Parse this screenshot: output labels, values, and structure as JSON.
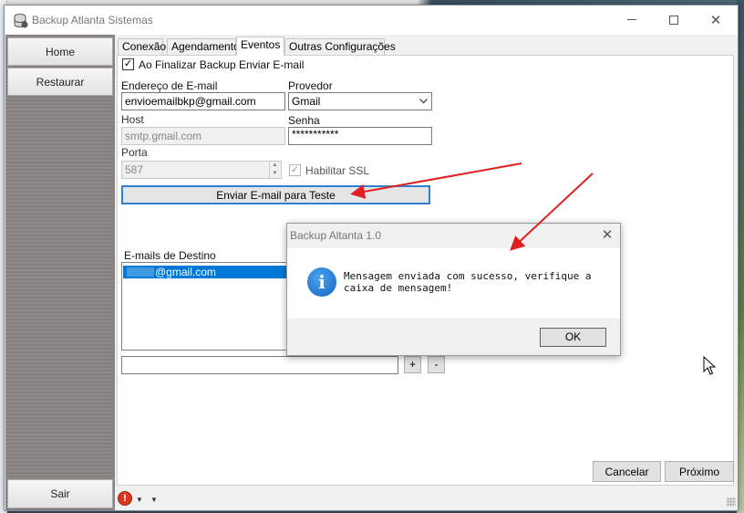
{
  "window": {
    "title": "Backup Atlanta Sistemas"
  },
  "sidebar": {
    "home_label": "Home",
    "restore_label": "Restaurar",
    "exit_label": "Sair"
  },
  "tabs": [
    {
      "label": "Conexão"
    },
    {
      "label": "Agendamento"
    },
    {
      "label": "Eventos",
      "active": true
    },
    {
      "label": "Outras Configurações"
    }
  ],
  "form": {
    "send_on_finish_label": "Ao Finalizar Backup Enviar E-mail",
    "send_on_finish_checked": true,
    "email_label": "Endereço de E-mail",
    "email_value": "envioemailbkp@gmail.com",
    "provider_label": "Provedor",
    "provider_value": "Gmail",
    "host_label": "Host",
    "host_value": "smtp.gmail.com",
    "password_label": "Senha",
    "password_value": "***********",
    "port_label": "Porta",
    "port_value": "587",
    "ssl_label": "Habilitar SSL",
    "ssl_checked": true,
    "send_test_label": "Enviar E-mail para Teste",
    "recipients_label": "E-mails de Destino",
    "recipients": [
      "@gmail.com"
    ],
    "add_label": "+",
    "remove_label": "-"
  },
  "footer": {
    "cancel_label": "Cancelar",
    "next_label": "Próximo"
  },
  "dialog": {
    "title": "Backup Altanta 1.0",
    "message": "Mensagem enviada com sucesso, verifique a caixa de mensagem!",
    "ok_label": "OK",
    "icon": "info-icon"
  },
  "colors": {
    "accent": "#0078d7",
    "arrow": "#e02020",
    "sidebar": "#8a8582"
  }
}
